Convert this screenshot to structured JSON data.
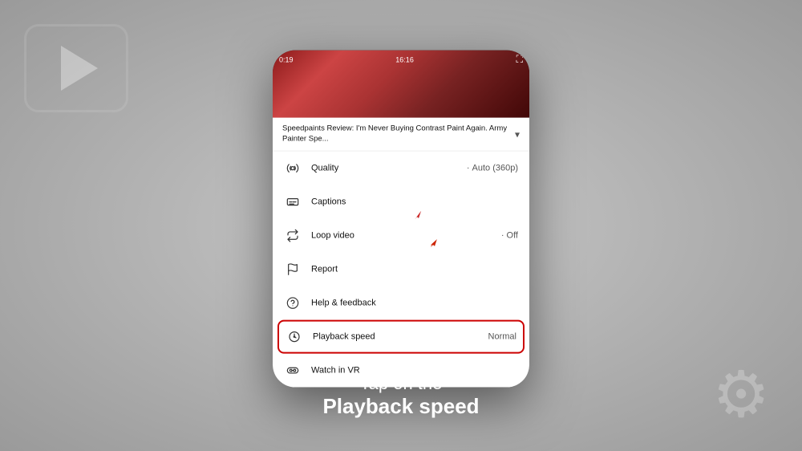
{
  "background": {
    "color_start": "#c8c8c8",
    "color_end": "#9a9a9a"
  },
  "phone": {
    "video": {
      "time_current": "0:19",
      "time_total": "16:16",
      "title": "Speedpaints Review: I'm Never Buying Contrast Paint Again. Army Painter Spe...",
      "chevron": "▾"
    },
    "menu": {
      "items": [
        {
          "id": "quality",
          "label": "Quality",
          "value": "Auto (360p)",
          "has_dot": true,
          "icon": "gear"
        },
        {
          "id": "captions",
          "label": "Captions",
          "value": "",
          "has_dot": false,
          "icon": "cc"
        },
        {
          "id": "loop",
          "label": "Loop video",
          "value": "Off",
          "has_dot": true,
          "icon": "loop"
        },
        {
          "id": "report",
          "label": "Report",
          "value": "",
          "has_dot": false,
          "icon": "flag"
        },
        {
          "id": "help",
          "label": "Help & feedback",
          "value": "",
          "has_dot": false,
          "icon": "help"
        },
        {
          "id": "playback",
          "label": "Playback speed",
          "value": "Normal",
          "has_dot": false,
          "icon": "speed",
          "highlighted": true
        },
        {
          "id": "watchvr",
          "label": "Watch in VR",
          "value": "",
          "has_dot": false,
          "icon": "vr"
        }
      ]
    }
  },
  "bottom_text": {
    "line1": "Tap on the",
    "line2": "Playback speed"
  },
  "arrow": {
    "color": "#cc2200"
  }
}
